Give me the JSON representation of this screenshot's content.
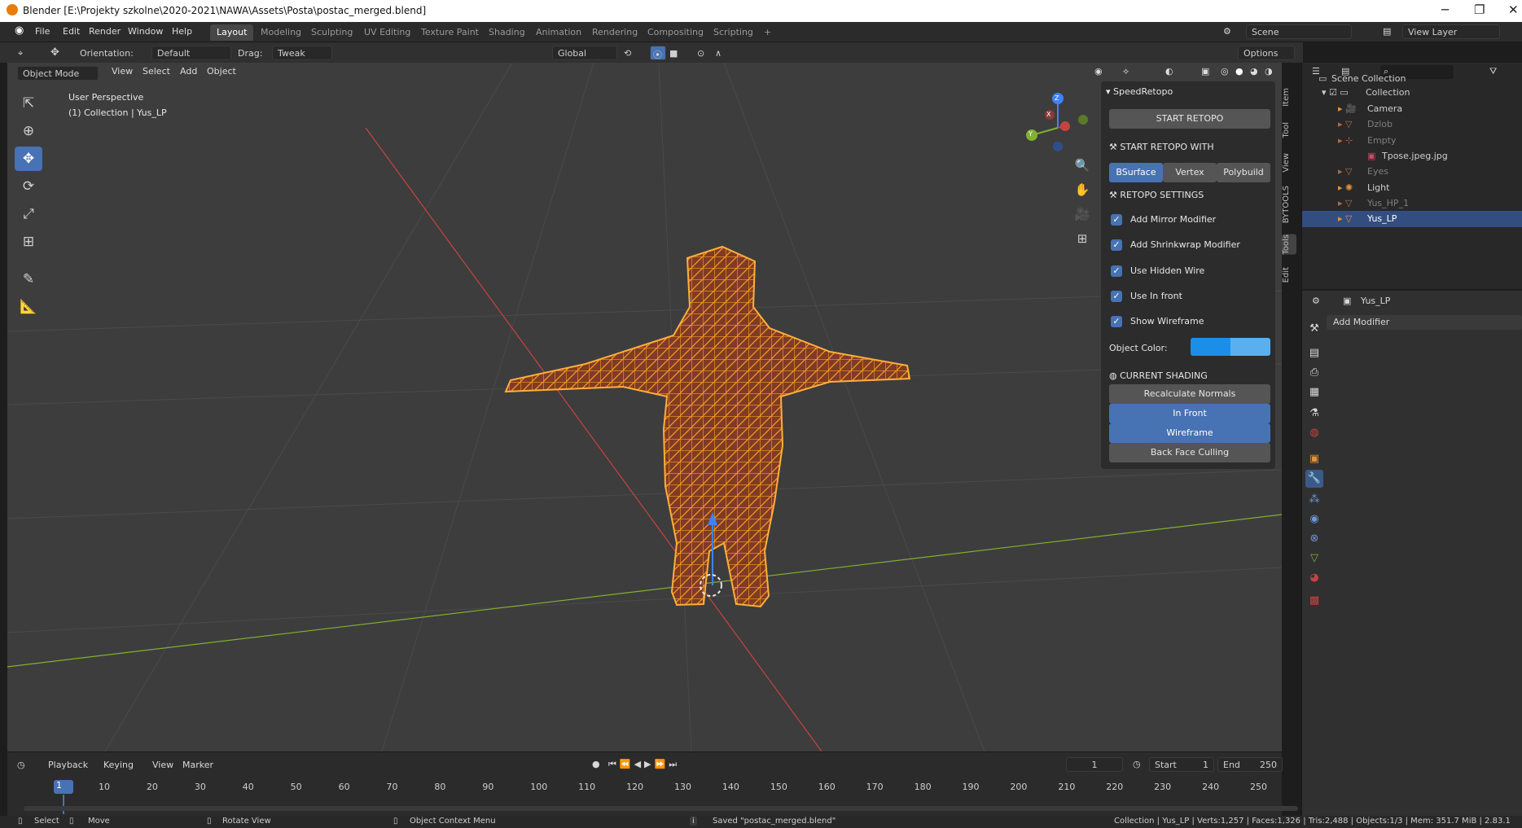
{
  "window": {
    "title": "Blender [E:\\Projekty szkolne\\2020-2021\\NAWA\\Assets\\Posta\\postac_merged.blend]",
    "minimize": "─",
    "restore": "❐",
    "close": "✕"
  },
  "menu": [
    "File",
    "Edit",
    "Render",
    "Window",
    "Help"
  ],
  "workspaces": [
    "Layout",
    "Modeling",
    "Sculpting",
    "UV Editing",
    "Texture Paint",
    "Shading",
    "Animation",
    "Rendering",
    "Compositing",
    "Scripting"
  ],
  "workspace_add": "+",
  "scene": {
    "scene_name": "Scene",
    "view_layer": "View Layer"
  },
  "header": {
    "orientation_label": "Orientation:",
    "orientation_value": "Default",
    "drag_label": "Drag:",
    "drag_value": "Tweak",
    "transform_orientation": "Global",
    "options": "Options"
  },
  "viewport_header": {
    "mode": "Object Mode",
    "view": "View",
    "select": "Select",
    "add": "Add",
    "object": "Object"
  },
  "overlay": {
    "perspective": "User Perspective",
    "collection": "(1) Collection | Yus_LP"
  },
  "gizmo": {
    "x": "X",
    "y": "Y",
    "z": "Z"
  },
  "npanel": {
    "title": "SpeedRetopo",
    "start": "START RETOPO",
    "start_with": "START RETOPO WITH",
    "modes": [
      "BSurface",
      "Vertex",
      "Polybuild"
    ],
    "settings": "RETOPO SETTINGS",
    "options": [
      "Add Mirror Modifier",
      "Add Shrinkwrap Modifier",
      "Use Hidden Wire",
      "Use In front",
      "Show Wireframe"
    ],
    "object_color_label": "Object Color:",
    "object_color": "#1b8fe8",
    "current_shading": "CURRENT SHADING",
    "recalc": "Recalculate Normals",
    "shading": [
      "In Front",
      "Wireframe",
      "Back Face Culling"
    ]
  },
  "side_tabs": [
    "Item",
    "Tool",
    "View",
    "BYTOOLS",
    "Tools",
    "Edit"
  ],
  "outliner": {
    "root": "Scene Collection",
    "collection": "Collection",
    "items": [
      "Camera",
      "Dzlob",
      "Empty",
      "Tpose.jpeg.jpg",
      "Eyes",
      "Light",
      "Yus_HP_1",
      "Yus_LP"
    ]
  },
  "properties": {
    "object_name": "Yus_LP",
    "add_modifier": "Add Modifier"
  },
  "timeline": {
    "menus": [
      "Playback",
      "Keying",
      "View",
      "Marker"
    ],
    "current_frame": "1",
    "start_label": "Start",
    "start": "1",
    "end_label": "End",
    "end": "250",
    "ticks": [
      "1",
      "10",
      "20",
      "30",
      "40",
      "50",
      "60",
      "70",
      "80",
      "90",
      "100",
      "110",
      "120",
      "130",
      "140",
      "150",
      "160",
      "170",
      "180",
      "190",
      "200",
      "210",
      "220",
      "230",
      "240",
      "250"
    ]
  },
  "status": {
    "select": "Select",
    "move": "Move",
    "rotate": "Rotate View",
    "context": "Object Context Menu",
    "saved": "Saved \"postac_merged.blend\"",
    "stats": "Collection | Yus_LP | Verts:1,257 | Faces:1,326 | Tris:2,488 | Objects:1/3 | Mem: 351.7 MiB | 2.83.1"
  },
  "colors": {
    "accent": "#4772b3",
    "wire": "#ff9a1f",
    "body": "#7a3b2a",
    "x_axis": "#c7433f",
    "y_axis": "#82b030"
  }
}
